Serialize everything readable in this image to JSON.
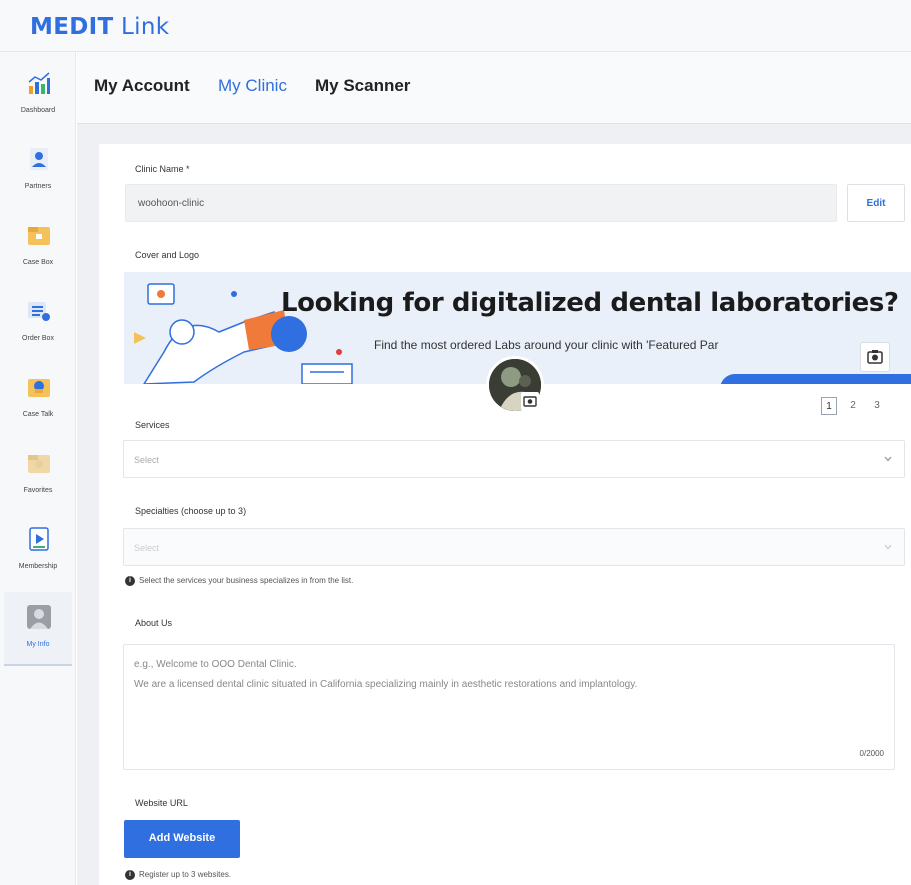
{
  "app": {
    "logo_part1": "MEDIT",
    "logo_part2": " Link"
  },
  "sidebar": {
    "items": [
      {
        "label": "Dashboard",
        "icon": "chart-icon"
      },
      {
        "label": "Partners",
        "icon": "person-icon"
      },
      {
        "label": "Case Box",
        "icon": "case-box-icon"
      },
      {
        "label": "Order Box",
        "icon": "order-box-icon"
      },
      {
        "label": "Case Talk",
        "icon": "case-talk-icon"
      },
      {
        "label": "Favorites",
        "icon": "favorites-icon"
      },
      {
        "label": "Membership",
        "icon": "membership-icon"
      },
      {
        "label": "My Info",
        "icon": "user-avatar-icon",
        "active": true
      }
    ]
  },
  "tabs": [
    "My Account",
    "My Clinic",
    "My Scanner"
  ],
  "active_tab": "My Clinic",
  "form": {
    "clinic_name_label": "Clinic Name *",
    "clinic_name_value": "woohoon-clinic",
    "edit_label": "Edit",
    "cover_logo_label": "Cover and Logo",
    "cover_headline": "Looking for digitalized dental laboratories?",
    "cover_subtext": "Find the most ordered Labs around your clinic with 'Featured Par",
    "pages": [
      "1",
      "2",
      "3"
    ],
    "active_page": "1",
    "services_label": "Services",
    "services_placeholder": "Select",
    "specialties_label": "Specialties (choose up to 3)",
    "specialties_placeholder": "Select",
    "specialties_hint": "Select the services your business specializes in from the list.",
    "about_label": "About Us",
    "about_placeholder_line1": "e.g., Welcome to OOO Dental Clinic.",
    "about_placeholder_line2": "We are a licensed dental clinic situated in California specializing mainly in aesthetic restorations and implantology.",
    "about_counter": "0/2000",
    "website_label": "Website URL",
    "add_website_label": "Add Website",
    "website_hint": "Register up to 3 websites."
  },
  "colors": {
    "accent": "#2f6fe0",
    "content_bg": "#eef0f3",
    "sidebar_bg": "#f7f8fa"
  }
}
